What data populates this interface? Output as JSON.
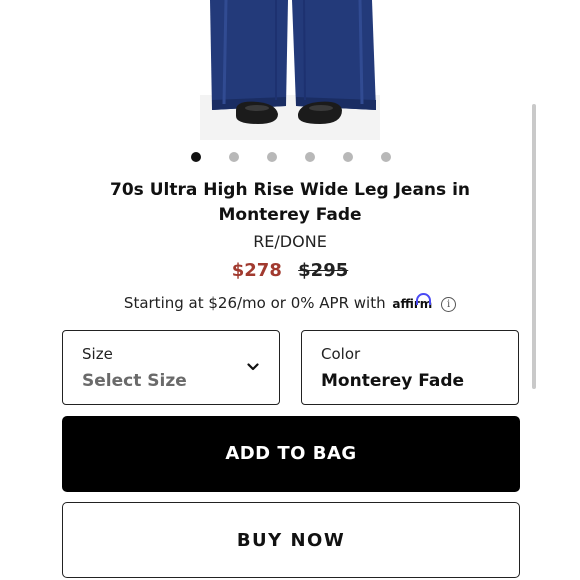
{
  "carousel": {
    "dot_count": 6,
    "active_index": 0
  },
  "product": {
    "title_line1": "70s Ultra High Rise Wide Leg Jeans in",
    "title_line2": "Monterey Fade",
    "brand": "RE/DONE",
    "price_sale": "$278",
    "price_original": "$295",
    "financing_text": "Starting at $26/mo or 0% APR with",
    "affirm_label": "affirm",
    "info_icon": "info-icon"
  },
  "size_select": {
    "label": "Size",
    "value": "Select Size",
    "icon": "chevron-down-icon"
  },
  "color_select": {
    "label": "Color",
    "value": "Monterey Fade"
  },
  "actions": {
    "add_to_bag": "ADD TO BAG",
    "buy_now": "BUY NOW"
  },
  "colors": {
    "sale_price": "#a13a2f",
    "denim": "#233a7a",
    "primary_button": "#000000",
    "affirm_arc": "#4a4af4"
  }
}
